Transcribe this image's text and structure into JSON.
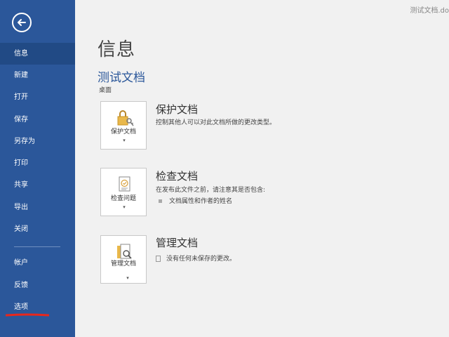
{
  "window": {
    "filename": "测试文档.do"
  },
  "sidebar": {
    "items": [
      {
        "label": "信息"
      },
      {
        "label": "新建"
      },
      {
        "label": "打开"
      },
      {
        "label": "保存"
      },
      {
        "label": "另存为"
      },
      {
        "label": "打印"
      },
      {
        "label": "共享"
      },
      {
        "label": "导出"
      },
      {
        "label": "关闭"
      },
      {
        "label": "帐户"
      },
      {
        "label": "反馈"
      },
      {
        "label": "选项"
      }
    ],
    "active": "信息"
  },
  "main": {
    "title": "信息",
    "doc_name": "测试文档",
    "doc_location": "桌面",
    "sections": [
      {
        "button_label": "保护文档",
        "title": "保护文档",
        "desc": "控制其他人可以对此文档所做的更改类型。"
      },
      {
        "button_label": "检查问题",
        "title": "检查文档",
        "desc": "在发布此文件之前，请注意其是否包含:",
        "bullets": [
          "文档属性和作者的姓名"
        ]
      },
      {
        "button_label": "管理文档",
        "title": "管理文档",
        "desc": "没有任何未保存的更改。"
      }
    ]
  },
  "colors": {
    "sidebar": "#2b579a",
    "sidebar_active": "#214a85",
    "accent_text": "#2b579a",
    "annotation": "#e8271c"
  },
  "icons": [
    "back-arrow-icon",
    "lock-key-icon",
    "checklist-icon",
    "manage-doc-icon",
    "caret-down-icon",
    "bullet-square-icon",
    "document-icon"
  ]
}
